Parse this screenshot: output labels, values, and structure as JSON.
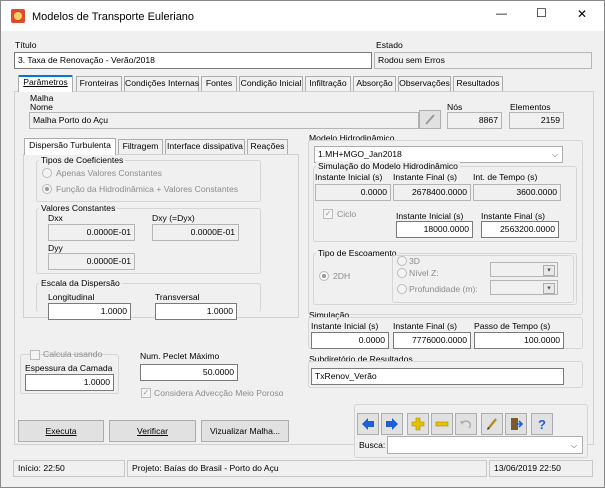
{
  "window": {
    "title": "Modelos de Transporte Euleriano",
    "minimize": "—",
    "maximize": "☐",
    "close": "✕"
  },
  "header": {
    "titulo_label": "Título",
    "titulo_value": "3. Taxa de Renovação - Verão/2018",
    "estado_label": "Estado",
    "estado_value": "Rodou sem Erros"
  },
  "tabs": [
    "Parâmetros",
    "Fronteiras",
    "Condições Internas",
    "Fontes",
    "Condição Inicial",
    "Infiltração",
    "Absorção",
    "Observações",
    "Resultados"
  ],
  "malha": {
    "group": "Malha",
    "nome_label": "Nome",
    "nome_value": "Malha Porto do Açu",
    "nos_label": "Nós",
    "nos_value": "8867",
    "elementos_label": "Elementos",
    "elementos_value": "2159"
  },
  "subtabs": [
    "Dispersão Turbulenta",
    "Filtragem",
    "Interface dissipativa",
    "Reações"
  ],
  "tipos": {
    "title": "Tipos de Coeficientes",
    "opt1": "Apenas Valores Constantes",
    "opt2": "Função da Hidrodinâmica + Valores Constantes"
  },
  "valores": {
    "title": "Valores Constantes",
    "dxx_label": "Dxx",
    "dxx_value": "0.0000E-01",
    "dxy_label": "Dxy (=Dyx)",
    "dxy_value": "0.0000E-01",
    "dyy_label": "Dyy",
    "dyy_value": "0.0000E-01"
  },
  "escala": {
    "title": "Escala da Dispersão",
    "long_label": "Longitudinal",
    "long_value": "1.0000",
    "trans_label": "Transversal",
    "trans_value": "1.0000"
  },
  "camada": {
    "calcula_label": "Calcula usando",
    "espessura_label": "Espessura da Camada",
    "espessura_value": "1.0000",
    "peclet_label": "Num. Peclet Máximo",
    "peclet_value": "50.0000",
    "advec_label": "Considera Advecção Meio Poroso"
  },
  "hidro": {
    "title": "Modelo Hidrodinâmico",
    "model_value": "1.MH+MGO_Jan2018",
    "sim_title": "Simulação do Modelo Hidrodinâmico",
    "ini_label": "Instante Inicial (s)",
    "ini_value": "0.0000",
    "fin_label": "Instante Final (s)",
    "fin_value": "2678400.0000",
    "int_label": "Int. de Tempo (s)",
    "int_value": "3600.0000",
    "ciclo_label": "Ciclo",
    "cini_label": "Instante Inicial (s)",
    "cini_value": "18000.0000",
    "cfin_label": "Instante Final (s)",
    "cfin_value": "2563200.0000"
  },
  "escoamento": {
    "title": "Tipo de Escoamento",
    "opt2dh": "2DH",
    "opt3d": "3D",
    "nivel": "Nível Z:",
    "prof": "Profundidade (m):"
  },
  "simulacao": {
    "title": "Simulação",
    "ini_label": "Instante Inicial (s)",
    "ini_value": "0.0000",
    "fin_label": "Instante Final (s)",
    "fin_value": "7776000.0000",
    "passo_label": "Passo de Tempo (s)",
    "passo_value": "100.0000"
  },
  "subdir": {
    "title": "Subdiretório de Resultados",
    "value": "TxRenov_Verão"
  },
  "buttons": {
    "executa": "Executa",
    "verificar": "Verificar",
    "visualizar": "Vizualizar Malha..."
  },
  "nav": {
    "busca_label": "Busca:",
    "busca_value": ""
  },
  "statusbar": {
    "inicio": "Início: 22:50",
    "projeto": "Projeto: Baías do Brasil - Porto do Açu",
    "data": "13/06/2019 22:50"
  },
  "colors": {
    "accent": "#0078d7",
    "nav_arrow": "#1f5fd6",
    "plus": "#e8c400"
  }
}
